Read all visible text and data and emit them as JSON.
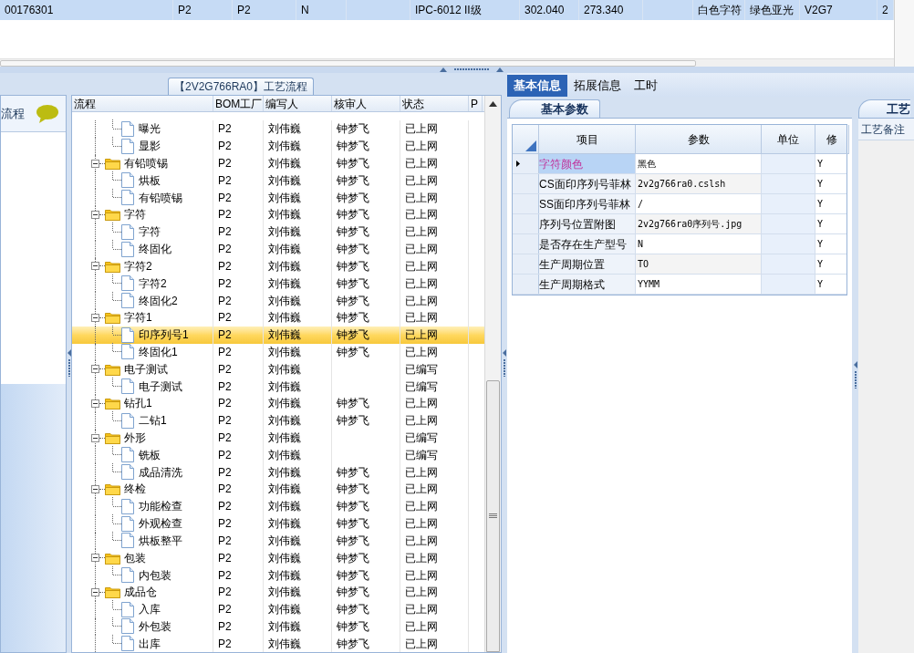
{
  "top_table": {
    "row": {
      "selected": true,
      "cells": [
        "00176301",
        "P2",
        "P2",
        "N",
        null,
        "IPC-6012 II级",
        "302.040",
        "273.340",
        null,
        "白色字符",
        "绿色亚光",
        "V2G7",
        "2"
      ]
    }
  },
  "side_panel": {
    "title": "流程"
  },
  "process_panel": {
    "title": "【2V2G766RA0】工艺流程",
    "columns": [
      "流程",
      "BOM工厂",
      "编写人",
      "核审人",
      "状态",
      "P"
    ],
    "tree": [
      {
        "children": [
          {
            "name": "曝光",
            "cells": [
              "P2",
              "刘伟巍",
              "钟梦飞",
              "已上网"
            ],
            "selected": false
          },
          {
            "name": "显影",
            "cells": [
              "P2",
              "刘伟巍",
              "钟梦飞",
              "已上网"
            ],
            "selected": false
          }
        ]
      },
      {
        "name": "有铅喷锡",
        "cells": [
          "P2",
          "刘伟巍",
          "钟梦飞",
          "已上网"
        ],
        "selected": false,
        "expanded": true,
        "children": [
          {
            "name": "烘板",
            "cells": [
              "P2",
              "刘伟巍",
              "钟梦飞",
              "已上网"
            ],
            "selected": false
          },
          {
            "name": "有铅喷锡",
            "cells": [
              "P2",
              "刘伟巍",
              "钟梦飞",
              "已上网"
            ],
            "selected": false
          }
        ]
      },
      {
        "name": "字符",
        "cells": [
          "P2",
          "刘伟巍",
          "钟梦飞",
          "已上网"
        ],
        "selected": false,
        "expanded": true,
        "children": [
          {
            "name": "字符",
            "cells": [
              "P2",
              "刘伟巍",
              "钟梦飞",
              "已上网"
            ],
            "selected": false
          },
          {
            "name": "终固化",
            "cells": [
              "P2",
              "刘伟巍",
              "钟梦飞",
              "已上网"
            ],
            "selected": false
          }
        ]
      },
      {
        "name": "字符2",
        "cells": [
          "P2",
          "刘伟巍",
          "钟梦飞",
          "已上网"
        ],
        "selected": false,
        "expanded": true,
        "children": [
          {
            "name": "字符2",
            "cells": [
              "P2",
              "刘伟巍",
              "钟梦飞",
              "已上网"
            ],
            "selected": false
          },
          {
            "name": "终固化2",
            "cells": [
              "P2",
              "刘伟巍",
              "钟梦飞",
              "已上网"
            ],
            "selected": false
          }
        ]
      },
      {
        "name": "字符1",
        "cells": [
          "P2",
          "刘伟巍",
          "钟梦飞",
          "已上网"
        ],
        "selected": false,
        "expanded": true,
        "children": [
          {
            "name": "印序列号1",
            "cells": [
              "P2",
              "刘伟巍",
              "钟梦飞",
              "已上网"
            ],
            "selected": true
          },
          {
            "name": "终固化1",
            "cells": [
              "P2",
              "刘伟巍",
              "钟梦飞",
              "已上网"
            ],
            "selected": false
          }
        ]
      },
      {
        "name": "电子测试",
        "cells": [
          "P2",
          "刘伟巍",
          null,
          "已编写"
        ],
        "selected": false,
        "expanded": true,
        "children": [
          {
            "name": "电子测试",
            "cells": [
              "P2",
              "刘伟巍",
              null,
              "已编写"
            ],
            "selected": false
          }
        ]
      },
      {
        "name": "钻孔1",
        "cells": [
          "P2",
          "刘伟巍",
          "钟梦飞",
          "已上网"
        ],
        "selected": false,
        "expanded": true,
        "children": [
          {
            "name": "二钻1",
            "cells": [
              "P2",
              "刘伟巍",
              "钟梦飞",
              "已上网"
            ],
            "selected": false
          }
        ]
      },
      {
        "name": "外形",
        "cells": [
          "P2",
          "刘伟巍",
          null,
          "已编写"
        ],
        "selected": false,
        "expanded": true,
        "children": [
          {
            "name": "铣板",
            "cells": [
              "P2",
              "刘伟巍",
              null,
              "已编写"
            ],
            "selected": false
          },
          {
            "name": "成品清洗",
            "cells": [
              "P2",
              "刘伟巍",
              "钟梦飞",
              "已上网"
            ],
            "selected": false
          }
        ]
      },
      {
        "name": "终检",
        "cells": [
          "P2",
          "刘伟巍",
          "钟梦飞",
          "已上网"
        ],
        "selected": false,
        "expanded": true,
        "children": [
          {
            "name": "功能检查",
            "cells": [
              "P2",
              "刘伟巍",
              "钟梦飞",
              "已上网"
            ],
            "selected": false
          },
          {
            "name": "外观检查",
            "cells": [
              "P2",
              "刘伟巍",
              "钟梦飞",
              "已上网"
            ],
            "selected": false
          },
          {
            "name": "烘板整平",
            "cells": [
              "P2",
              "刘伟巍",
              "钟梦飞",
              "已上网"
            ],
            "selected": false
          }
        ]
      },
      {
        "name": "包装",
        "cells": [
          "P2",
          "刘伟巍",
          "钟梦飞",
          "已上网"
        ],
        "selected": false,
        "expanded": true,
        "children": [
          {
            "name": "内包装",
            "cells": [
              "P2",
              "刘伟巍",
              "钟梦飞",
              "已上网"
            ],
            "selected": false
          }
        ]
      },
      {
        "name": "成品仓",
        "cells": [
          "P2",
          "刘伟巍",
          "钟梦飞",
          "已上网"
        ],
        "selected": false,
        "expanded": true,
        "children": [
          {
            "name": "入库",
            "cells": [
              "P2",
              "刘伟巍",
              "钟梦飞",
              "已上网"
            ],
            "selected": false
          },
          {
            "name": "外包装",
            "cells": [
              "P2",
              "刘伟巍",
              "钟梦飞",
              "已上网"
            ],
            "selected": false
          },
          {
            "name": "出库",
            "cells": [
              "P2",
              "刘伟巍",
              "钟梦飞",
              "已上网"
            ],
            "selected": false
          }
        ]
      }
    ]
  },
  "detail_panel": {
    "tabs": [
      {
        "label": "基本信息",
        "selected": true
      },
      {
        "label": "拓展信息",
        "selected": false
      },
      {
        "label": "工时",
        "selected": false
      }
    ],
    "params": {
      "tab": "基本参数",
      "columns": [
        "项目",
        "参数",
        "单位",
        "修"
      ],
      "rows": [
        {
          "item": "字符颜色",
          "value": "黑色",
          "unit": null,
          "modified": "Y",
          "selected": true
        },
        {
          "item": "CS面印序列号菲林",
          "value": "2v2g766ra0.cslsh",
          "unit": null,
          "modified": "Y",
          "selected": false
        },
        {
          "item": "SS面印序列号菲林",
          "value": "/",
          "unit": null,
          "modified": "Y",
          "selected": false
        },
        {
          "item": "序列号位置附图",
          "value": "2v2g766ra0序列号.jpg",
          "unit": null,
          "modified": "Y",
          "selected": false
        },
        {
          "item": "是否存在生产型号",
          "value": "N",
          "unit": null,
          "modified": "Y",
          "selected": false
        },
        {
          "item": "生产周期位置",
          "value": "TO",
          "unit": null,
          "modified": "Y",
          "selected": false
        },
        {
          "item": "生产周期格式",
          "value": "YYMM",
          "unit": null,
          "modified": "Y",
          "selected": false
        }
      ]
    },
    "notes": {
      "tab": "工艺",
      "header": "工艺备注"
    }
  }
}
